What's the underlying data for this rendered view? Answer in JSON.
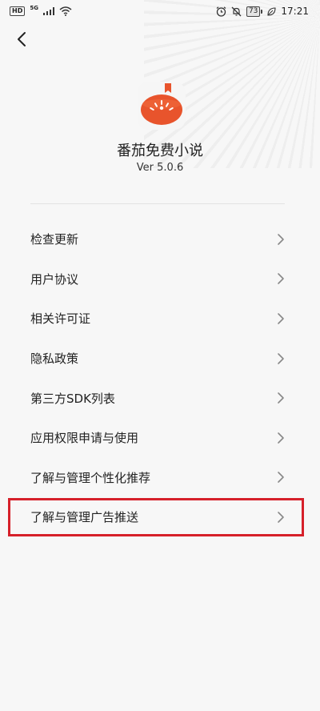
{
  "status_bar": {
    "hd": "HD",
    "network": "5G",
    "battery": "73",
    "time": "17:21"
  },
  "app": {
    "name": "番茄免费小说",
    "version": "Ver 5.0.6",
    "accent_color": "#e8542c"
  },
  "menu": {
    "items": [
      {
        "label": "检查更新"
      },
      {
        "label": "用户协议"
      },
      {
        "label": "相关许可证"
      },
      {
        "label": "隐私政策"
      },
      {
        "label": "第三方SDK列表"
      },
      {
        "label": "应用权限申请与使用"
      },
      {
        "label": "了解与管理个性化推荐"
      },
      {
        "label": "了解与管理广告推送"
      }
    ]
  },
  "icons": {
    "back": "chevron-left-icon",
    "chevron": "chevron-right-icon"
  },
  "highlight": {
    "color": "#d6202a",
    "target_index": 7
  }
}
